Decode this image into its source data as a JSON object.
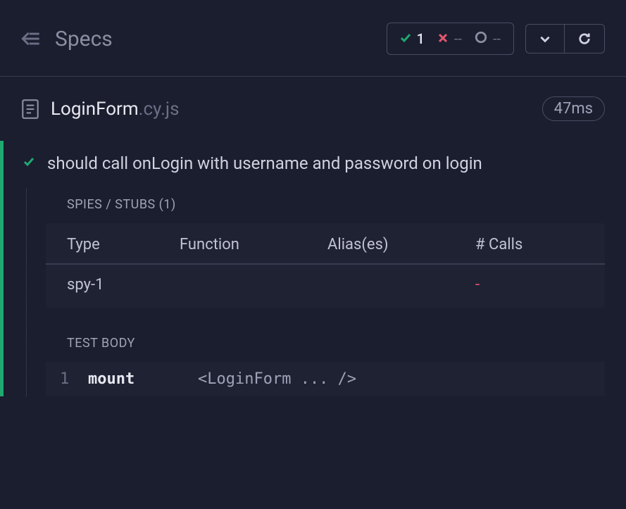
{
  "header": {
    "title": "Specs",
    "stats": {
      "passed": "1",
      "failed": "--",
      "pending": "--"
    }
  },
  "spec": {
    "filename_main": "LoginForm",
    "filename_ext": ".cy.js",
    "duration": "47ms"
  },
  "test": {
    "title": "should call onLogin with username and password on login",
    "spies_label": "SPIES / STUBS (1)",
    "spies_table": {
      "headers": {
        "type": "Type",
        "function": "Function",
        "aliases": "Alias(es)",
        "calls": "# Calls"
      },
      "rows": [
        {
          "type": "spy-1",
          "function": "",
          "aliases": "",
          "calls": "-"
        }
      ]
    },
    "body_label": "TEST BODY",
    "commands": [
      {
        "num": "1",
        "name": "mount",
        "args": "<LoginForm ... />"
      }
    ]
  }
}
